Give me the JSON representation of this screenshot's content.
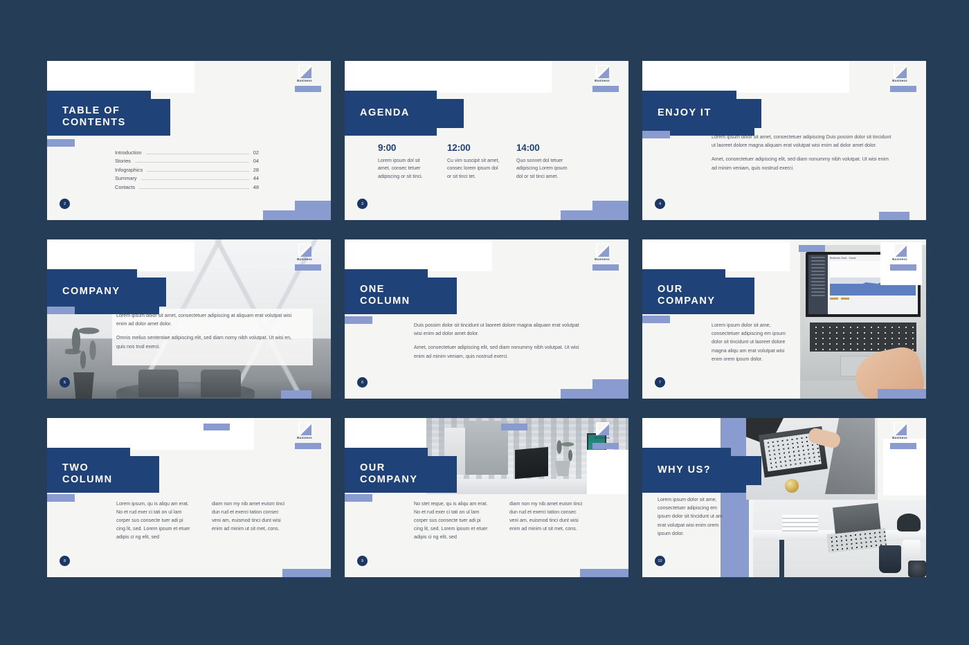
{
  "canvas": {
    "background": "#253d57",
    "slide_background": "#f5f5f4",
    "navy": "#1f4279",
    "periwinkle": "#8a9bd0",
    "badge_navy": "#1b3765",
    "body_text_color": "#50565f"
  },
  "brand": {
    "name": "Business",
    "mark_icon": "diagonal-square-logo-icon"
  },
  "slides": [
    {
      "id": "table-of-contents",
      "title_lines": [
        "TABLE OF",
        "CONTENTS"
      ],
      "page_number": "2",
      "toc": [
        {
          "label": "Introduction",
          "page": "02"
        },
        {
          "label": "Stories",
          "page": "04"
        },
        {
          "label": "Infographics",
          "page": "28"
        },
        {
          "label": "Summary",
          "page": "44"
        },
        {
          "label": "Contacts",
          "page": "48"
        }
      ]
    },
    {
      "id": "agenda",
      "title_lines": [
        "AGENDA"
      ],
      "page_number": "3",
      "agenda": [
        {
          "time": "9:00",
          "desc": "Lorem ipsum dol sit amet, consec tetuer adipiscing or sit tinci."
        },
        {
          "time": "12:00",
          "desc": "Cu vim suscipit sit amet, consec lorem ipsum dol or sit tinci tet."
        },
        {
          "time": "14:00",
          "desc": "Quo sonnet dol tetuer adipiscing Lorem ipsum dol or sit tinci amet."
        }
      ]
    },
    {
      "id": "enjoy-it",
      "title_lines": [
        "ENJOY IT"
      ],
      "page_number": "4",
      "paragraphs": [
        "Lorem ipsum dolor sit amet, consectetuer adipiscing Duis possim dolor sit tincidunt ut laoreet dolore magna aliquam erat volutpat wisi enim ad dolor amet dolor.",
        "Amet, consectetuer adipiscing elit, sed diam nonummy nibh volutpat. Ut wisi enim ad minim veniam, quis nostrud exerci."
      ]
    },
    {
      "id": "company",
      "title_lines": [
        "COMPANY"
      ],
      "page_number": "5",
      "photo": "office-lobby-photo",
      "paragraphs": [
        "Lorem ipsum dolor sit amet, consectetuer adipiscing at aliquam erat volutpat wisi enim ad dolor amet dolor.",
        "Omnis melius sententiae adipiscing elit, sed diam nomy nibh volutpat. Ut wisi en, quis nos trud exerci."
      ]
    },
    {
      "id": "one-column",
      "title_lines": [
        "ONE",
        "COLUMN"
      ],
      "page_number": "6",
      "paragraphs": [
        "Duis possim dolor sit tincidunt ut laoreet dolore magna aliquam erat volutpat wisi enim ad dolor amet dolor.",
        "Amet, consectetuer adipiscing elit, sed diam nonummy nibh volutpat. Ut wisi enim ad minim veniam, quis nostrud exerci."
      ]
    },
    {
      "id": "our-company-laptop",
      "title_lines": [
        "OUR",
        "COMPANY"
      ],
      "page_number": "7",
      "photo": "laptop-with-chart-photo",
      "laptop_screen_caption": "Business Chart - Visual",
      "paragraphs": [
        "Lorem ipsum dolor sit ame, consectetuer adipiscing em ipsum dolor sit tincidunt ut laoreet dolore magna aliqu am erat volutpat wisi enim orem ipsum dolor."
      ]
    },
    {
      "id": "two-column",
      "title_lines": [
        "TWO",
        "COLUMN"
      ],
      "page_number": "8",
      "columns": [
        "Lorem ipsum, qu is aliqu am erat. No et rud exer ci tati on ul lam corper sus consecte tuer adi pi cing lit, sed. Lorem ipsum et etuer adipis ci ng elit, sed",
        "diam non my nib amet euism tinci dun rud et exerci tation consec veni am, euismod tinci dunt wisi enim ad minim ut sit met, cons."
      ]
    },
    {
      "id": "our-company-desk",
      "title_lines": [
        "OUR",
        "COMPANY"
      ],
      "page_number": "9",
      "photo": "office-desk-photo",
      "columns": [
        "No stet reque, qu is aliqu am erat. No et rud exer ci tati on ul lam corper sus consecte tuer adi pi cing lit, sed. Lorem ipsum et etuer adipis ci ng elit, sed",
        "diam non my nib amet euism tinci dun rud et exerci tation consec veni am, euismod tinci dunt wisi enim ad minim ut sit met, cons."
      ]
    },
    {
      "id": "why-us",
      "title_lines": [
        "WHY US?"
      ],
      "page_number": "10",
      "photo": "desk-laptops-photo",
      "paragraphs": [
        "Lorem ipsum dolor sit ame, consectetuer adipiscing em ipsum dolor sit tincidunt ut am erat volutpat wisi enim orem ipsum dolor."
      ]
    }
  ]
}
